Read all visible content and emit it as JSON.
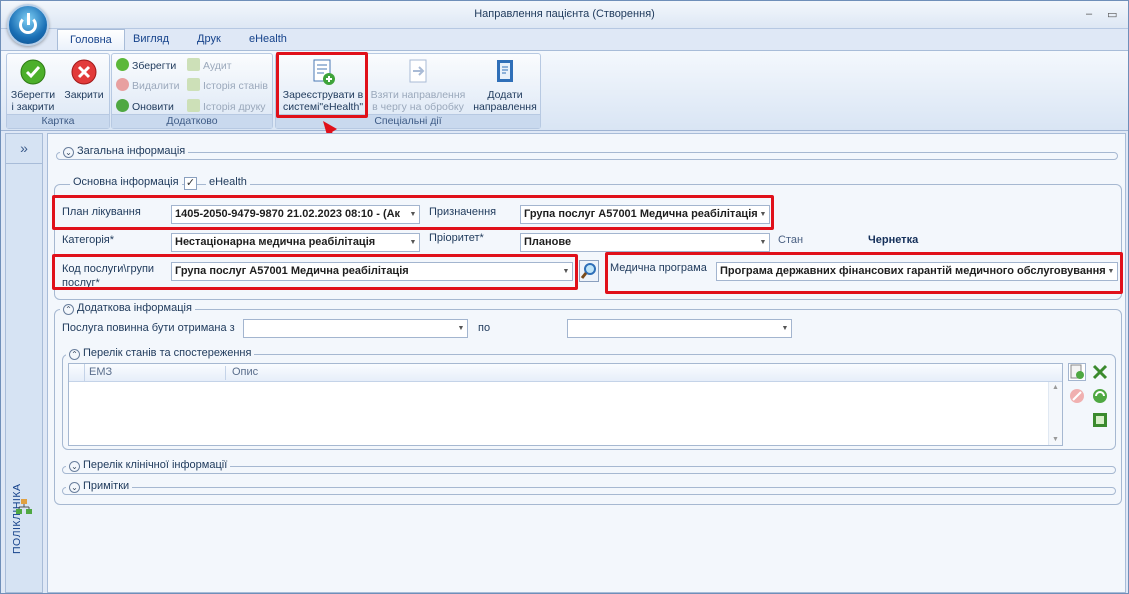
{
  "window": {
    "title": "Направлення пацієнта (Створення)",
    "minimize_glyph": "–",
    "maximize_glyph": "▭"
  },
  "tabs": [
    "Головна",
    "Вигляд",
    "Друк",
    "eHealth"
  ],
  "ribbon": {
    "karta": {
      "label": "Картка",
      "save_close": [
        "Зберегти",
        "і закрити"
      ],
      "close": "Закрити"
    },
    "dodatkovo": {
      "label": "Додатково",
      "save": "Зберегти",
      "delete": "Видалити",
      "refresh": "Оновити",
      "audit": "Аудит",
      "state_history": "Історія станів",
      "print_history": "Історія друку"
    },
    "special": {
      "label": "Спеціальні дії",
      "register": [
        "Зареєструвати в",
        "системі\"eHealth\""
      ],
      "take": [
        "Взяти направлення",
        "в чергу на обробку"
      ],
      "add": [
        "Додати",
        "направлення"
      ]
    }
  },
  "sidebar": {
    "expand_glyph": "»",
    "label": "ПОЛІКЛІНІКА"
  },
  "sections": {
    "general": "Загальна інформація",
    "main_info": "Основна інформація",
    "ehealth_label": "eHealth",
    "ehealth_checked": "✓",
    "additional": "Додаткова інформація",
    "states": "Перелік станів та спостереження",
    "clinical": "Перелік клінічної інформації",
    "notes": "Примітки"
  },
  "form": {
    "plan_label": "План лікування",
    "plan_value": "1405-2050-9479-9870 21.02.2023 08:10 - (Ак",
    "purpose_label": "Призначення",
    "purpose_value": "Група послуг A57001 Медична реабілітація",
    "category_label": "Категорія*",
    "category_value": "Нестаціонарна медична реабілітація",
    "priority_label": "Пріоритет*",
    "priority_value": "Планове",
    "status_label": "Стан",
    "status_value": "Чернетка",
    "service_label": [
      "Код послуги\\групи",
      "послуг*"
    ],
    "service_value": "Група послуг A57001 Медична реабілітація",
    "program_label": "Медична програма",
    "program_value": "Програма державних фінансових гарантій медичного обслуговування н",
    "received_from_label": "Послуга повинна бути отримана з",
    "to_label": "по",
    "received_from_value": "",
    "to_value": ""
  },
  "grid": {
    "columns": [
      "ЕМЗ",
      "Опис"
    ]
  }
}
